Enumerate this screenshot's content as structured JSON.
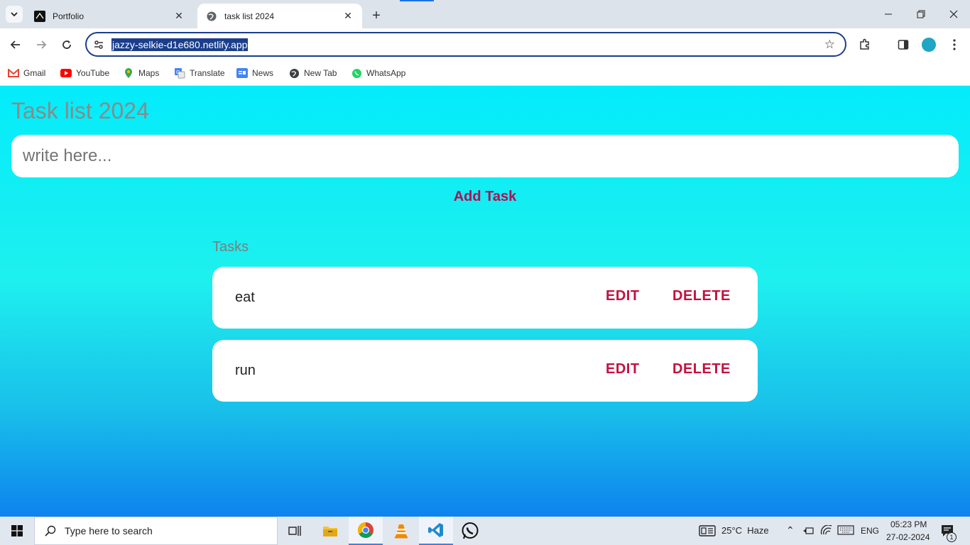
{
  "browser": {
    "tabs": [
      {
        "title": "Portfolio",
        "active": false
      },
      {
        "title": "task list 2024",
        "active": true
      }
    ],
    "url": "jazzy-selkie-d1e680.netlify.app",
    "bookmarks": [
      {
        "label": "Gmail",
        "icon": "gmail-icon"
      },
      {
        "label": "YouTube",
        "icon": "youtube-icon"
      },
      {
        "label": "Maps",
        "icon": "maps-icon"
      },
      {
        "label": "Translate",
        "icon": "translate-icon"
      },
      {
        "label": "News",
        "icon": "news-icon"
      },
      {
        "label": "New Tab",
        "icon": "globe-icon"
      },
      {
        "label": "WhatsApp",
        "icon": "whatsapp-icon"
      }
    ]
  },
  "app": {
    "title": "Task list 2024",
    "input_placeholder": "write here...",
    "add_label": "Add Task",
    "tasks_heading": "Tasks",
    "tasks": [
      {
        "text": "eat",
        "edit_label": "EDIT",
        "delete_label": "DELETE"
      },
      {
        "text": "run",
        "edit_label": "EDIT",
        "delete_label": "DELETE"
      }
    ],
    "colors": {
      "accent": "#c4103f",
      "add_button": "#b00e55",
      "bg_top": "#03ecfb",
      "bg_bottom": "#0d83ee"
    }
  },
  "taskbar": {
    "search_placeholder": "Type here to search",
    "weather": "25°C  Haze",
    "language": "ENG",
    "time": "05:23 PM",
    "date": "27-02-2024",
    "notification_count": "1"
  }
}
